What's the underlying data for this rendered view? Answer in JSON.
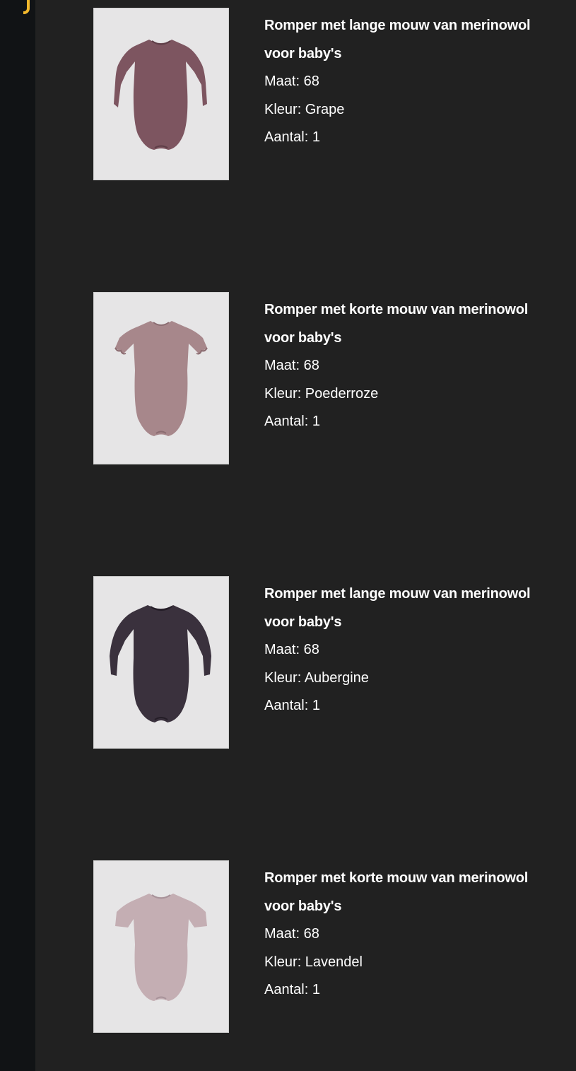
{
  "ui": {
    "accent_color": "#f4b92c",
    "background_color": "#212121",
    "rail_color": "#111315"
  },
  "items": [
    {
      "title": "Romper met lange mouw van merinowol voor baby's",
      "size": "Maat: 68",
      "color": "Kleur: Grape",
      "quantity": "Aantal: 1",
      "image": "romper-long-sleeve-grape-image",
      "swatch": "#7d5560"
    },
    {
      "title": "Romper met korte mouw van merinowol voor baby's",
      "size": "Maat: 68",
      "color": "Kleur: Poederroze",
      "quantity": "Aantal: 1",
      "image": "romper-short-sleeve-poederroze-image",
      "swatch": "#a7878b"
    },
    {
      "title": "Romper met lange mouw van merinowol voor baby's",
      "size": "Maat: 68",
      "color": "Kleur: Aubergine",
      "quantity": "Aantal: 1",
      "image": "romper-long-sleeve-aubergine-image",
      "swatch": "#3a313d"
    },
    {
      "title": "Romper met korte mouw van merinowol voor baby's",
      "size": "Maat: 68",
      "color": "Kleur: Lavendel",
      "quantity": "Aantal: 1",
      "image": "romper-short-sleeve-lavendel-image",
      "swatch": "#c4aeb3"
    }
  ]
}
